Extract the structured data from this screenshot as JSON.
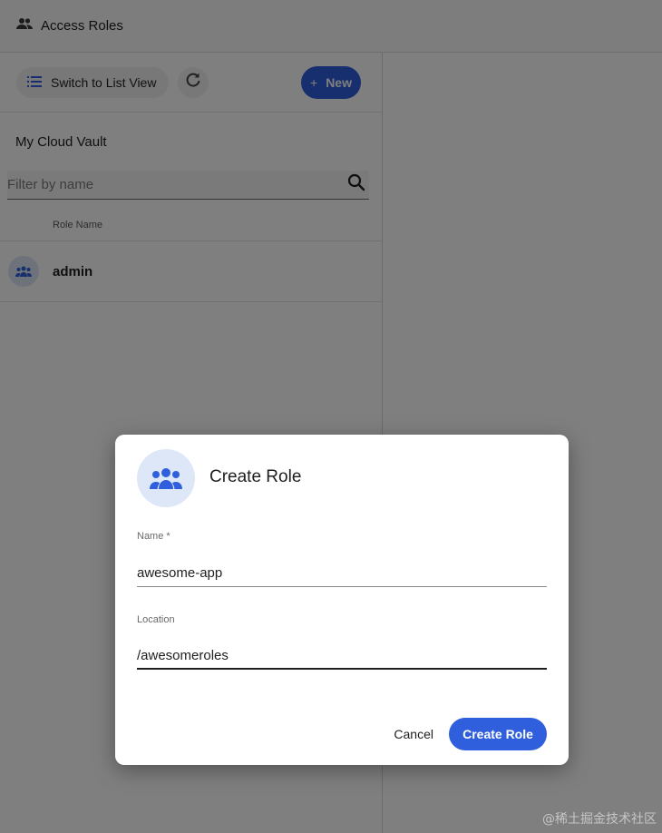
{
  "header": {
    "title": "Access Roles",
    "icon": "people-icon"
  },
  "toolbar": {
    "switch_view_label": "Switch to List View",
    "new_label": "New",
    "new_icon": "+",
    "accent": "#2f5fdc"
  },
  "vault": {
    "title": "My Cloud Vault"
  },
  "filter": {
    "placeholder": "Filter by name"
  },
  "table": {
    "column_header": "Role Name",
    "rows": [
      {
        "name": "admin"
      }
    ]
  },
  "dialog": {
    "title": "Create Role",
    "name_label": "Name *",
    "name_value": "awesome-app",
    "location_label": "Location",
    "location_value": "/awesomeroles",
    "cancel_label": "Cancel",
    "create_label": "Create Role"
  },
  "watermark": "@稀土掘金技术社区"
}
